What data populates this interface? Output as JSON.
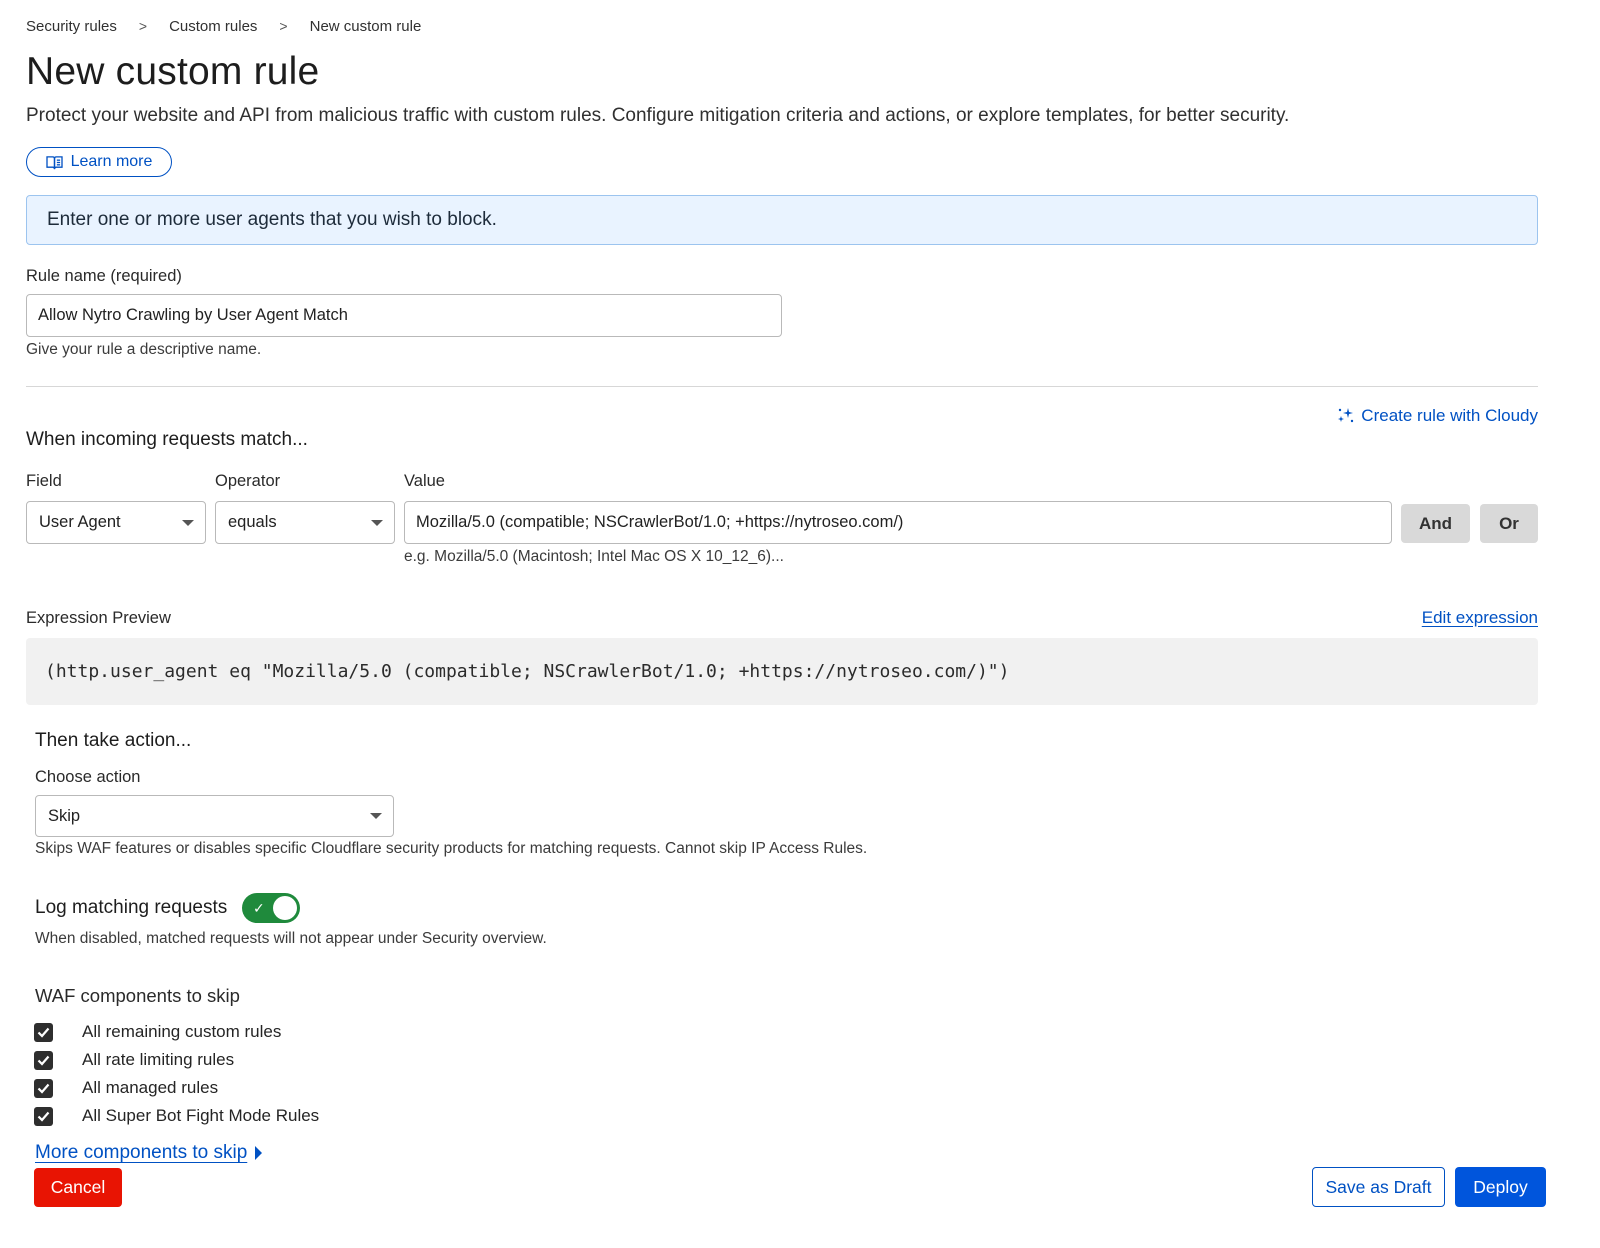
{
  "breadcrumb": {
    "items": [
      "Security rules",
      "Custom rules",
      "New custom rule"
    ],
    "separator": ">"
  },
  "page": {
    "title": "New custom rule",
    "description": "Protect your website and API from malicious traffic with custom rules. Configure mitigation criteria and actions, or explore templates, for better security.",
    "learn_more_label": "Learn more",
    "learn_more_icon": "book-icon"
  },
  "banner": {
    "text": "Enter one or more user agents that you wish to block."
  },
  "rule_name": {
    "label": "Rule name (required)",
    "value": "Allow Nytro Crawling by User Agent Match",
    "help": "Give your rule a descriptive name."
  },
  "match": {
    "cloudy_link": "Create rule with Cloudy",
    "cloudy_icon": "sparkle-icon",
    "heading": "When incoming requests match...",
    "field_label": "Field",
    "field_value": "User Agent",
    "operator_label": "Operator",
    "operator_value": "equals",
    "value_label": "Value",
    "value_value": "Mozilla/5.0 (compatible; NSCrawlerBot/1.0; +https://nytroseo.com/)",
    "value_help": "e.g. Mozilla/5.0 (Macintosh; Intel Mac OS X 10_12_6)...",
    "and_label": "And",
    "or_label": "Or"
  },
  "expression": {
    "label": "Expression Preview",
    "edit_label": "Edit expression",
    "text": "(http.user_agent eq \"Mozilla/5.0 (compatible; NSCrawlerBot/1.0; +https://nytroseo.com/)\")"
  },
  "action": {
    "heading": "Then take action...",
    "choose_label": "Choose action",
    "selected": "Skip",
    "help": "Skips WAF features or disables specific Cloudflare security products for matching requests. Cannot skip IP Access Rules."
  },
  "logging": {
    "label": "Log matching requests",
    "enabled": true,
    "help": "When disabled, matched requests will not appear under Security overview."
  },
  "waf": {
    "heading": "WAF components to skip",
    "components": [
      {
        "label": "All remaining custom rules",
        "checked": true
      },
      {
        "label": "All rate limiting rules",
        "checked": true
      },
      {
        "label": "All managed rules",
        "checked": true
      },
      {
        "label": "All Super Bot Fight Mode Rules",
        "checked": true
      }
    ],
    "more_label": "More components to skip"
  },
  "footer": {
    "cancel_label": "Cancel",
    "draft_label": "Save as Draft",
    "deploy_label": "Deploy"
  },
  "colors": {
    "link": "#0051c3",
    "primary": "#0055dc",
    "danger": "#e81403",
    "toggle_on": "#1f8a3c",
    "banner_bg": "#e9f3ff"
  }
}
